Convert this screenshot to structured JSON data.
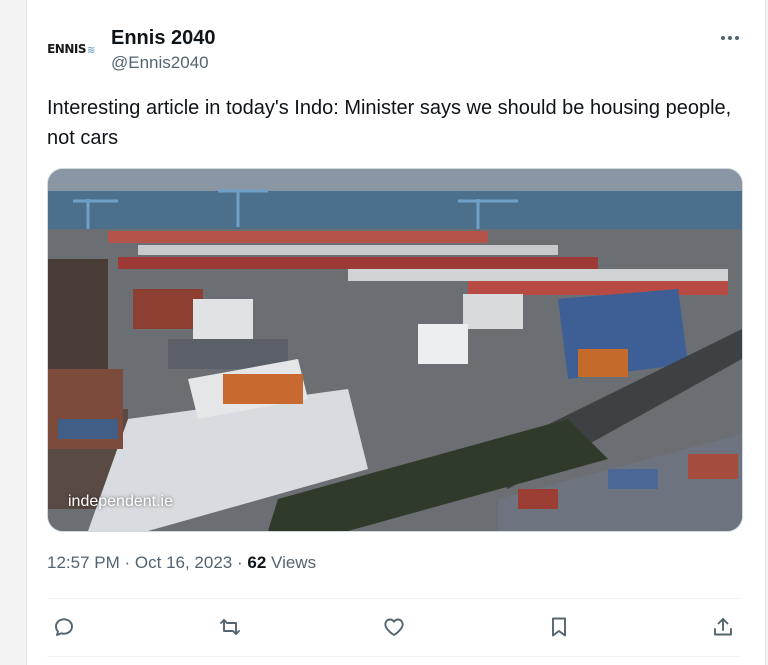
{
  "author": {
    "avatar_logo": "ENNIS",
    "avatar_logo_mark": "≋",
    "name": "Ennis 2040",
    "handle": "@Ennis2040"
  },
  "tweet": {
    "text": "Interesting article in today's Indo: Minister says we should be housing people, not cars",
    "image_watermark": "independent.ie",
    "time": "12:57 PM",
    "separator": "·",
    "date": "Oct 16, 2023",
    "views_count": "62",
    "views_label": "Views"
  },
  "icons": {
    "more": "more-horizontal-icon",
    "reply": "reply-icon",
    "retweet": "retweet-icon",
    "like": "heart-icon",
    "bookmark": "bookmark-icon",
    "share": "share-icon"
  },
  "colors": {
    "text_primary": "#0f1419",
    "text_secondary": "#536471",
    "divider": "#eff3f4"
  }
}
